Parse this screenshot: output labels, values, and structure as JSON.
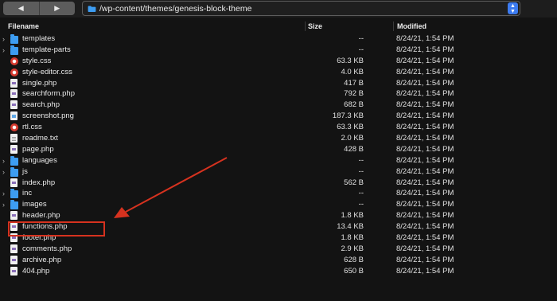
{
  "toolbar": {
    "back_icon": "◀",
    "forward_icon": "▶",
    "path": "/wp-content/themes/genesis-block-theme",
    "path_stepper_up": "▲",
    "path_stepper_down": "▼"
  },
  "columns": {
    "filename": "Filename",
    "size": "Size",
    "modified": "Modified"
  },
  "files": [
    {
      "name": "templates",
      "type": "folder",
      "size": "--",
      "modified": "8/24/21, 1:54 PM"
    },
    {
      "name": "template-parts",
      "type": "folder",
      "size": "--",
      "modified": "8/24/21, 1:54 PM"
    },
    {
      "name": "style.css",
      "type": "css",
      "size": "63.3 KB",
      "modified": "8/24/21, 1:54 PM"
    },
    {
      "name": "style-editor.css",
      "type": "css",
      "size": "4.0 KB",
      "modified": "8/24/21, 1:54 PM"
    },
    {
      "name": "single.php",
      "type": "php",
      "size": "417 B",
      "modified": "8/24/21, 1:54 PM"
    },
    {
      "name": "searchform.php",
      "type": "php",
      "size": "792 B",
      "modified": "8/24/21, 1:54 PM"
    },
    {
      "name": "search.php",
      "type": "php",
      "size": "682 B",
      "modified": "8/24/21, 1:54 PM"
    },
    {
      "name": "screenshot.png",
      "type": "png",
      "size": "187.3 KB",
      "modified": "8/24/21, 1:54 PM"
    },
    {
      "name": "rtl.css",
      "type": "css",
      "size": "63.3 KB",
      "modified": "8/24/21, 1:54 PM"
    },
    {
      "name": "readme.txt",
      "type": "txt",
      "size": "2.0 KB",
      "modified": "8/24/21, 1:54 PM"
    },
    {
      "name": "page.php",
      "type": "php",
      "size": "428 B",
      "modified": "8/24/21, 1:54 PM"
    },
    {
      "name": "languages",
      "type": "folder",
      "size": "--",
      "modified": "8/24/21, 1:54 PM"
    },
    {
      "name": "js",
      "type": "folder",
      "size": "--",
      "modified": "8/24/21, 1:54 PM"
    },
    {
      "name": "index.php",
      "type": "php",
      "size": "562 B",
      "modified": "8/24/21, 1:54 PM"
    },
    {
      "name": "inc",
      "type": "folder",
      "size": "--",
      "modified": "8/24/21, 1:54 PM"
    },
    {
      "name": "images",
      "type": "folder",
      "size": "--",
      "modified": "8/24/21, 1:54 PM"
    },
    {
      "name": "header.php",
      "type": "php",
      "size": "1.8 KB",
      "modified": "8/24/21, 1:54 PM"
    },
    {
      "name": "functions.php",
      "type": "php",
      "size": "13.4 KB",
      "modified": "8/24/21, 1:54 PM"
    },
    {
      "name": "footer.php",
      "type": "php",
      "size": "1.8 KB",
      "modified": "8/24/21, 1:54 PM"
    },
    {
      "name": "comments.php",
      "type": "php",
      "size": "2.9 KB",
      "modified": "8/24/21, 1:54 PM"
    },
    {
      "name": "archive.php",
      "type": "php",
      "size": "628 B",
      "modified": "8/24/21, 1:54 PM"
    },
    {
      "name": "404.php",
      "type": "php",
      "size": "650 B",
      "modified": "8/24/21, 1:54 PM"
    }
  ],
  "disclosure_icon": "›",
  "annotation": {
    "highlighted_file": "functions.php",
    "color": "#d6321f"
  }
}
